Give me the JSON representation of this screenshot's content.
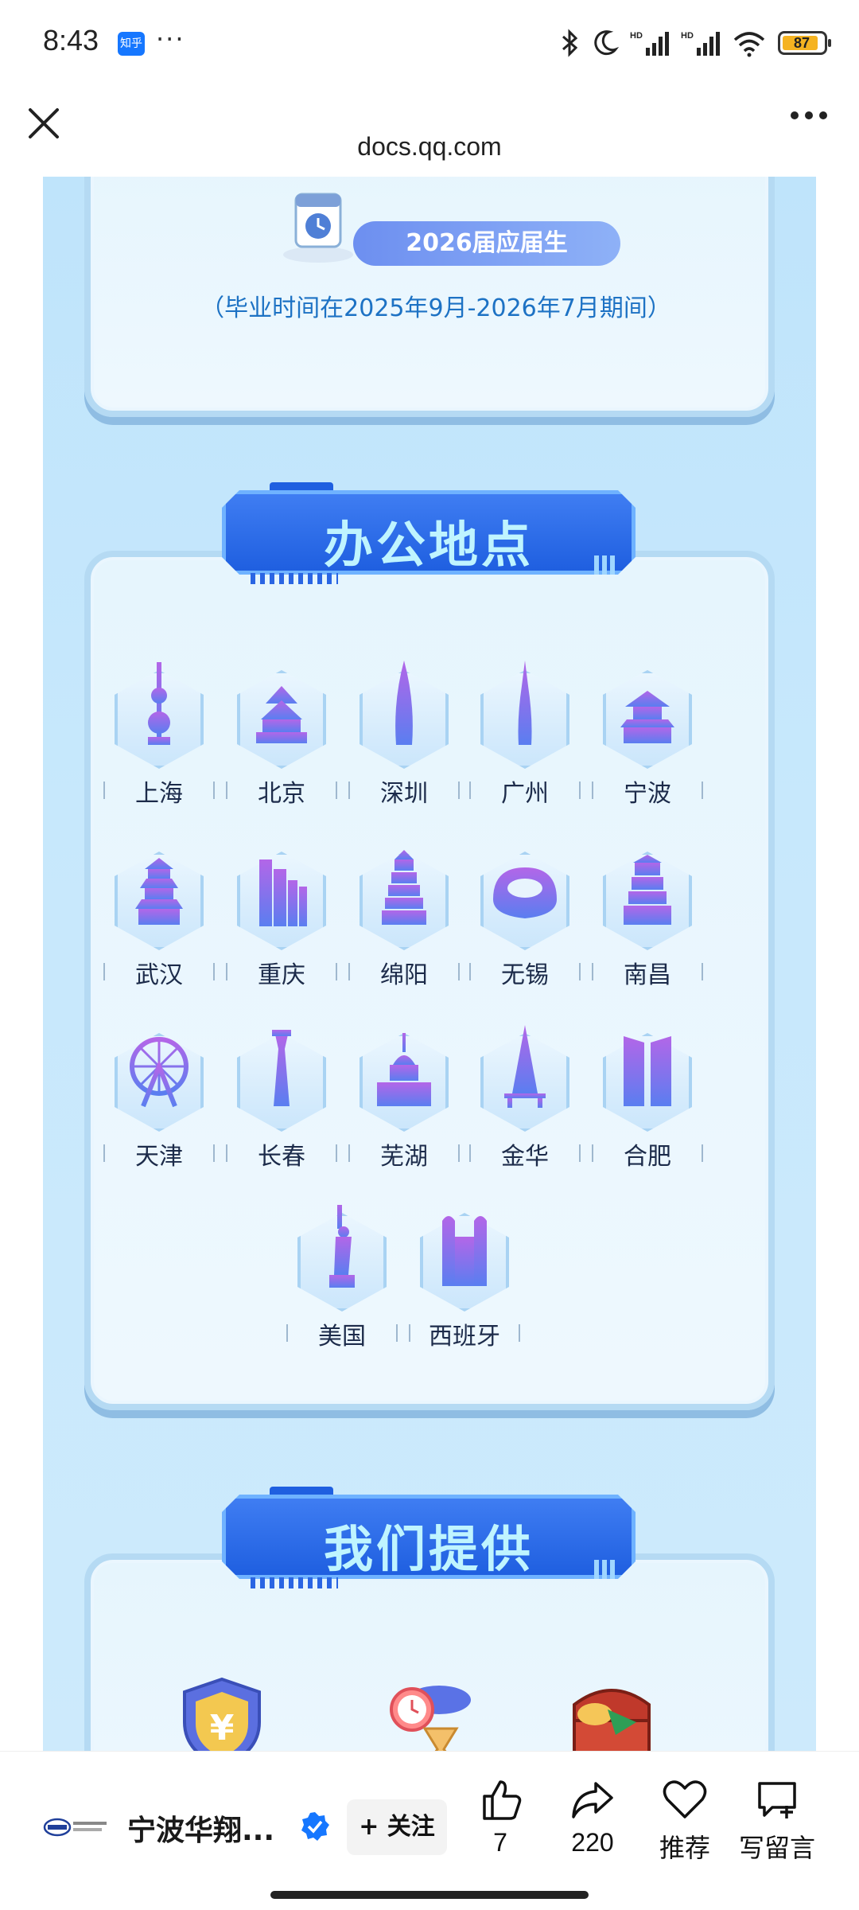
{
  "status_bar": {
    "time": "8:43",
    "app_badge": "知乎",
    "more": "···",
    "battery": "87",
    "icons": [
      "bluetooth-icon",
      "moon-icon",
      "signal-icon",
      "signal-icon",
      "wifi-icon",
      "battery-icon"
    ]
  },
  "nav": {
    "url": "docs.qq.com"
  },
  "poster": {
    "graduate_tag": "2026届应届生",
    "graduate_note": "（毕业时间在2025年9月-2026年7月期间）",
    "locations_title": "办公地点",
    "cities": [
      "上海",
      "北京",
      "深圳",
      "广州",
      "宁波",
      "武汉",
      "重庆",
      "绵阳",
      "无锡",
      "南昌",
      "天津",
      "长春",
      "芜湖",
      "金华",
      "合肥",
      "美国",
      "西班牙"
    ],
    "offer_title": "我们提供"
  },
  "bottom_bar": {
    "account_name": "宁波华翔...",
    "follow_label": "+ 关注",
    "like_count": "7",
    "share_count": "220",
    "recommend_label": "推荐",
    "comment_label": "写留言"
  },
  "colors": {
    "ribbon": "#2a65e3",
    "accent_text": "#1d72c4",
    "verified": "#1677ff"
  }
}
